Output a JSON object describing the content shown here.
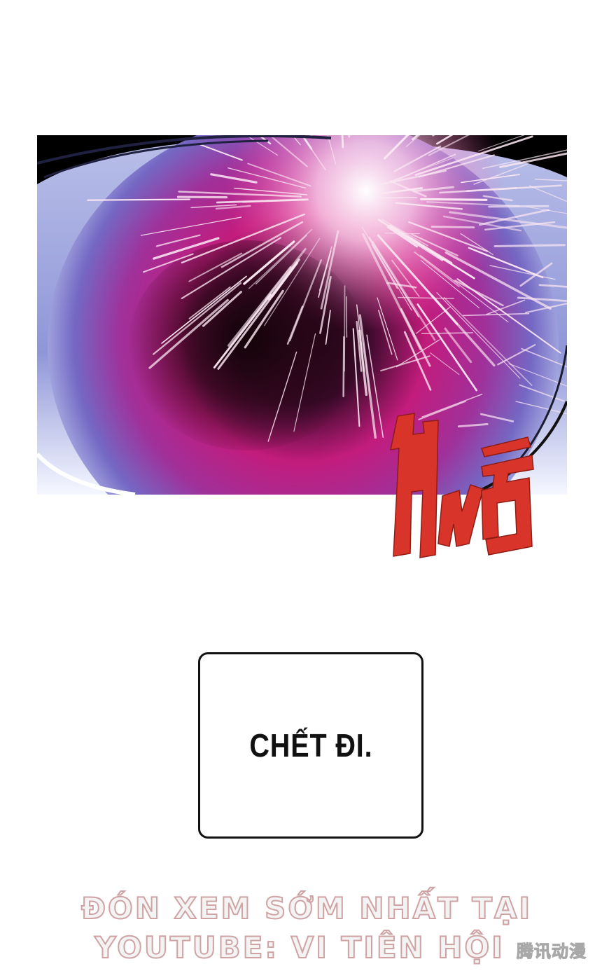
{
  "panel": {
    "subject": "glowing-eye-pupil",
    "colors": {
      "background": "#000000",
      "iris_outer": "#7468c4",
      "iris_inner": "#c21c7c",
      "pupil": "#1a0610",
      "highlight": "#ffffff",
      "sclera_edge": "#eef2fb"
    }
  },
  "sfx": {
    "color": "#d9342a"
  },
  "caption": {
    "text": "CHẾT ĐI."
  },
  "watermark": {
    "line1": "ĐÓN XEM SỚM NHẤT TẠI",
    "line2": "YOUTUBE: VI TIÊN HỘI",
    "logo": "腾讯动漫"
  }
}
